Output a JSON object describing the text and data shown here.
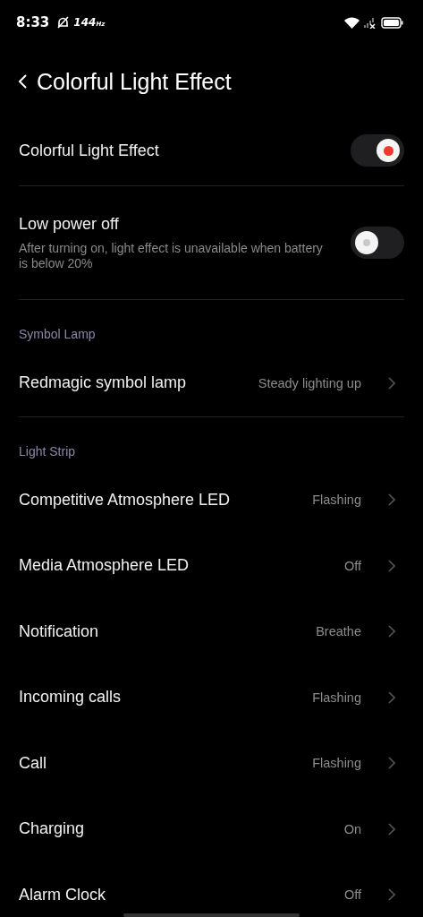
{
  "status_bar": {
    "time": "8:33",
    "refresh_rate": "144",
    "refresh_unit": "Hz"
  },
  "header": {
    "title": "Colorful Light Effect"
  },
  "toggles": [
    {
      "label": "Colorful Light Effect",
      "on": true
    },
    {
      "label": "Low power off",
      "description": "After turning on, light effect is unavailable when battery is below 20%",
      "on": false
    }
  ],
  "sections": [
    {
      "title": "Symbol Lamp",
      "items": [
        {
          "label": "Redmagic symbol lamp",
          "value": "Steady lighting up"
        }
      ]
    },
    {
      "title": "Light Strip",
      "items": [
        {
          "label": "Competitive Atmosphere LED",
          "value": "Flashing"
        },
        {
          "label": "Media Atmosphere LED",
          "value": "Off"
        },
        {
          "label": "Notification",
          "value": "Breathe"
        },
        {
          "label": "Incoming calls",
          "value": "Flashing"
        },
        {
          "label": "Call",
          "value": "Flashing"
        },
        {
          "label": "Charging",
          "value": "On"
        },
        {
          "label": "Alarm Clock",
          "value": "Off"
        }
      ]
    }
  ]
}
